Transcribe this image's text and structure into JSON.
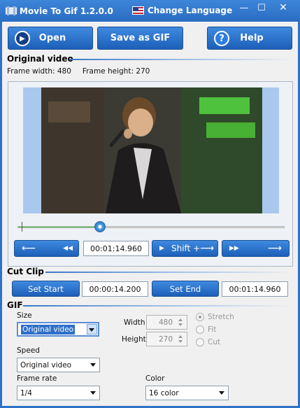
{
  "window": {
    "title": "Movie To Gif 1.2.0.0",
    "language_label": "Change Language",
    "min_glyph": "—",
    "max_glyph": "☐",
    "close_glyph": "✕"
  },
  "toolbar": {
    "open_label": "Open",
    "save_gif_label": "Save as GIF",
    "help_label": "Help"
  },
  "original_video": {
    "heading": "Original video",
    "frame_width_text": "Frame width: 480",
    "frame_height_text": "Frame height: 270",
    "playback_progress": 0.31,
    "back_label": "⟵",
    "rewind_label": "◀◀",
    "current_time": "00:01:14.960",
    "shift_label": "Shift +",
    "shift_arrow": "⟶",
    "forward_label": "▶▶",
    "next_label": "⟶"
  },
  "cut_clip": {
    "heading": "Cut Clip",
    "set_start_label": "Set Start",
    "start_time": "00:00:14.200",
    "set_end_label": "Set End",
    "end_time": "00:01:14.960"
  },
  "gif": {
    "heading": "GIF",
    "size_label": "Size",
    "size_value": "Original video",
    "width_label": "Width",
    "width_value": "480",
    "height_label": "Height",
    "height_value": "270",
    "stretch_label": "Stretch",
    "fit_label": "Fit",
    "cut_label": "Cut",
    "speed_label": "Speed",
    "speed_value": "Original video",
    "frame_rate_label": "Frame rate",
    "frame_rate_value": "1/4",
    "color_label": "Color",
    "color_value": "16 color"
  },
  "colors": {
    "accent": "#2e72c8",
    "button": "#2a6cc4",
    "progress": "#3dc13d"
  }
}
